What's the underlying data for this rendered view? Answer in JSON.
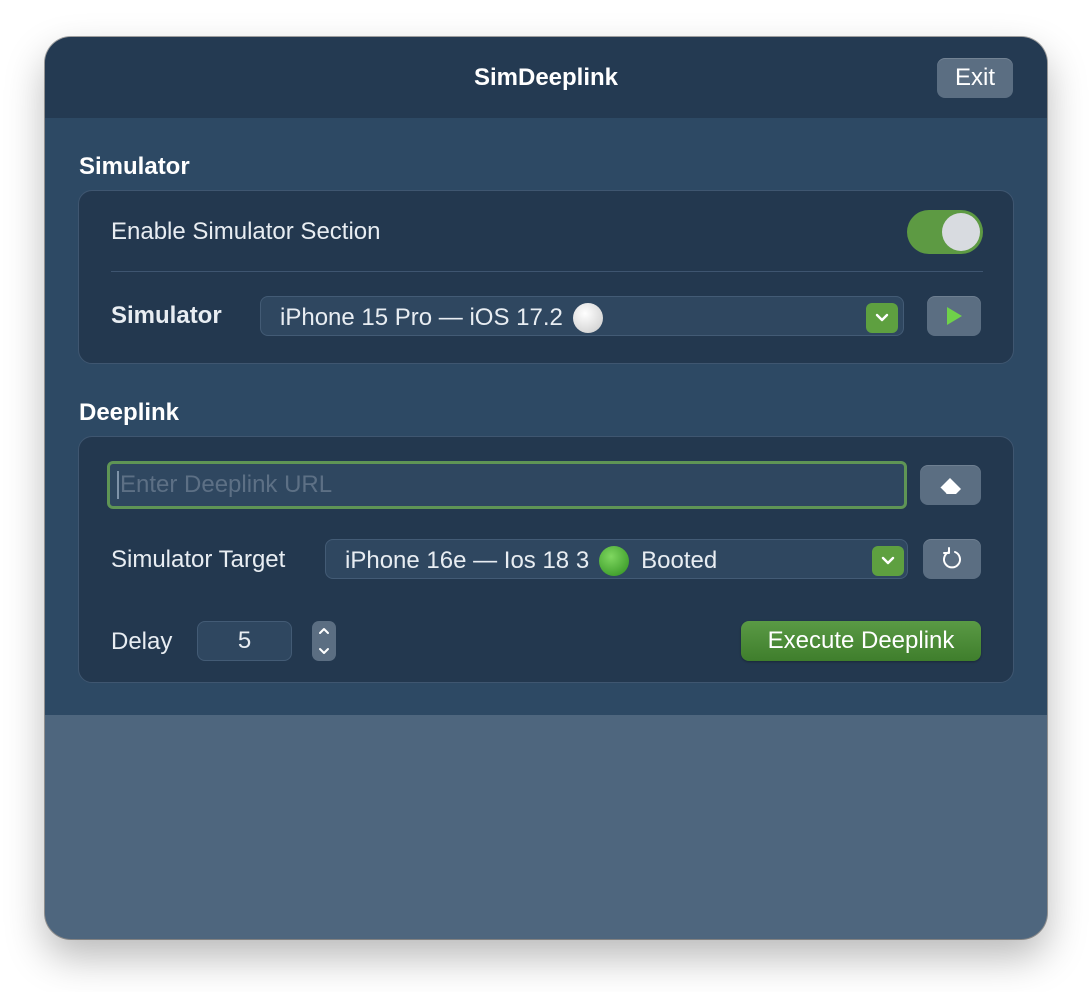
{
  "window": {
    "title": "SimDeeplink",
    "exit_label": "Exit"
  },
  "simulator_section": {
    "header": "Simulator",
    "enable_label": "Enable Simulator Section",
    "enabled": true,
    "simulator_label": "Simulator",
    "simulator_value": "iPhone 15 Pro — iOS 17.2",
    "simulator_status_dot": "white"
  },
  "deeplink_section": {
    "header": "Deeplink",
    "url_placeholder": "Enter Deeplink URL",
    "url_value": "",
    "target_label": "Simulator Target",
    "target_value": "iPhone 16e — Ios 18 3",
    "target_status_dot": "green",
    "target_status": "Booted",
    "delay_label": "Delay",
    "delay_value": "5",
    "execute_label": "Execute Deeplink"
  },
  "colors": {
    "accent_green": "#5ea040",
    "titlebar": "#243a52",
    "content_bg": "#2d4964",
    "card_bg": "#23384f"
  }
}
